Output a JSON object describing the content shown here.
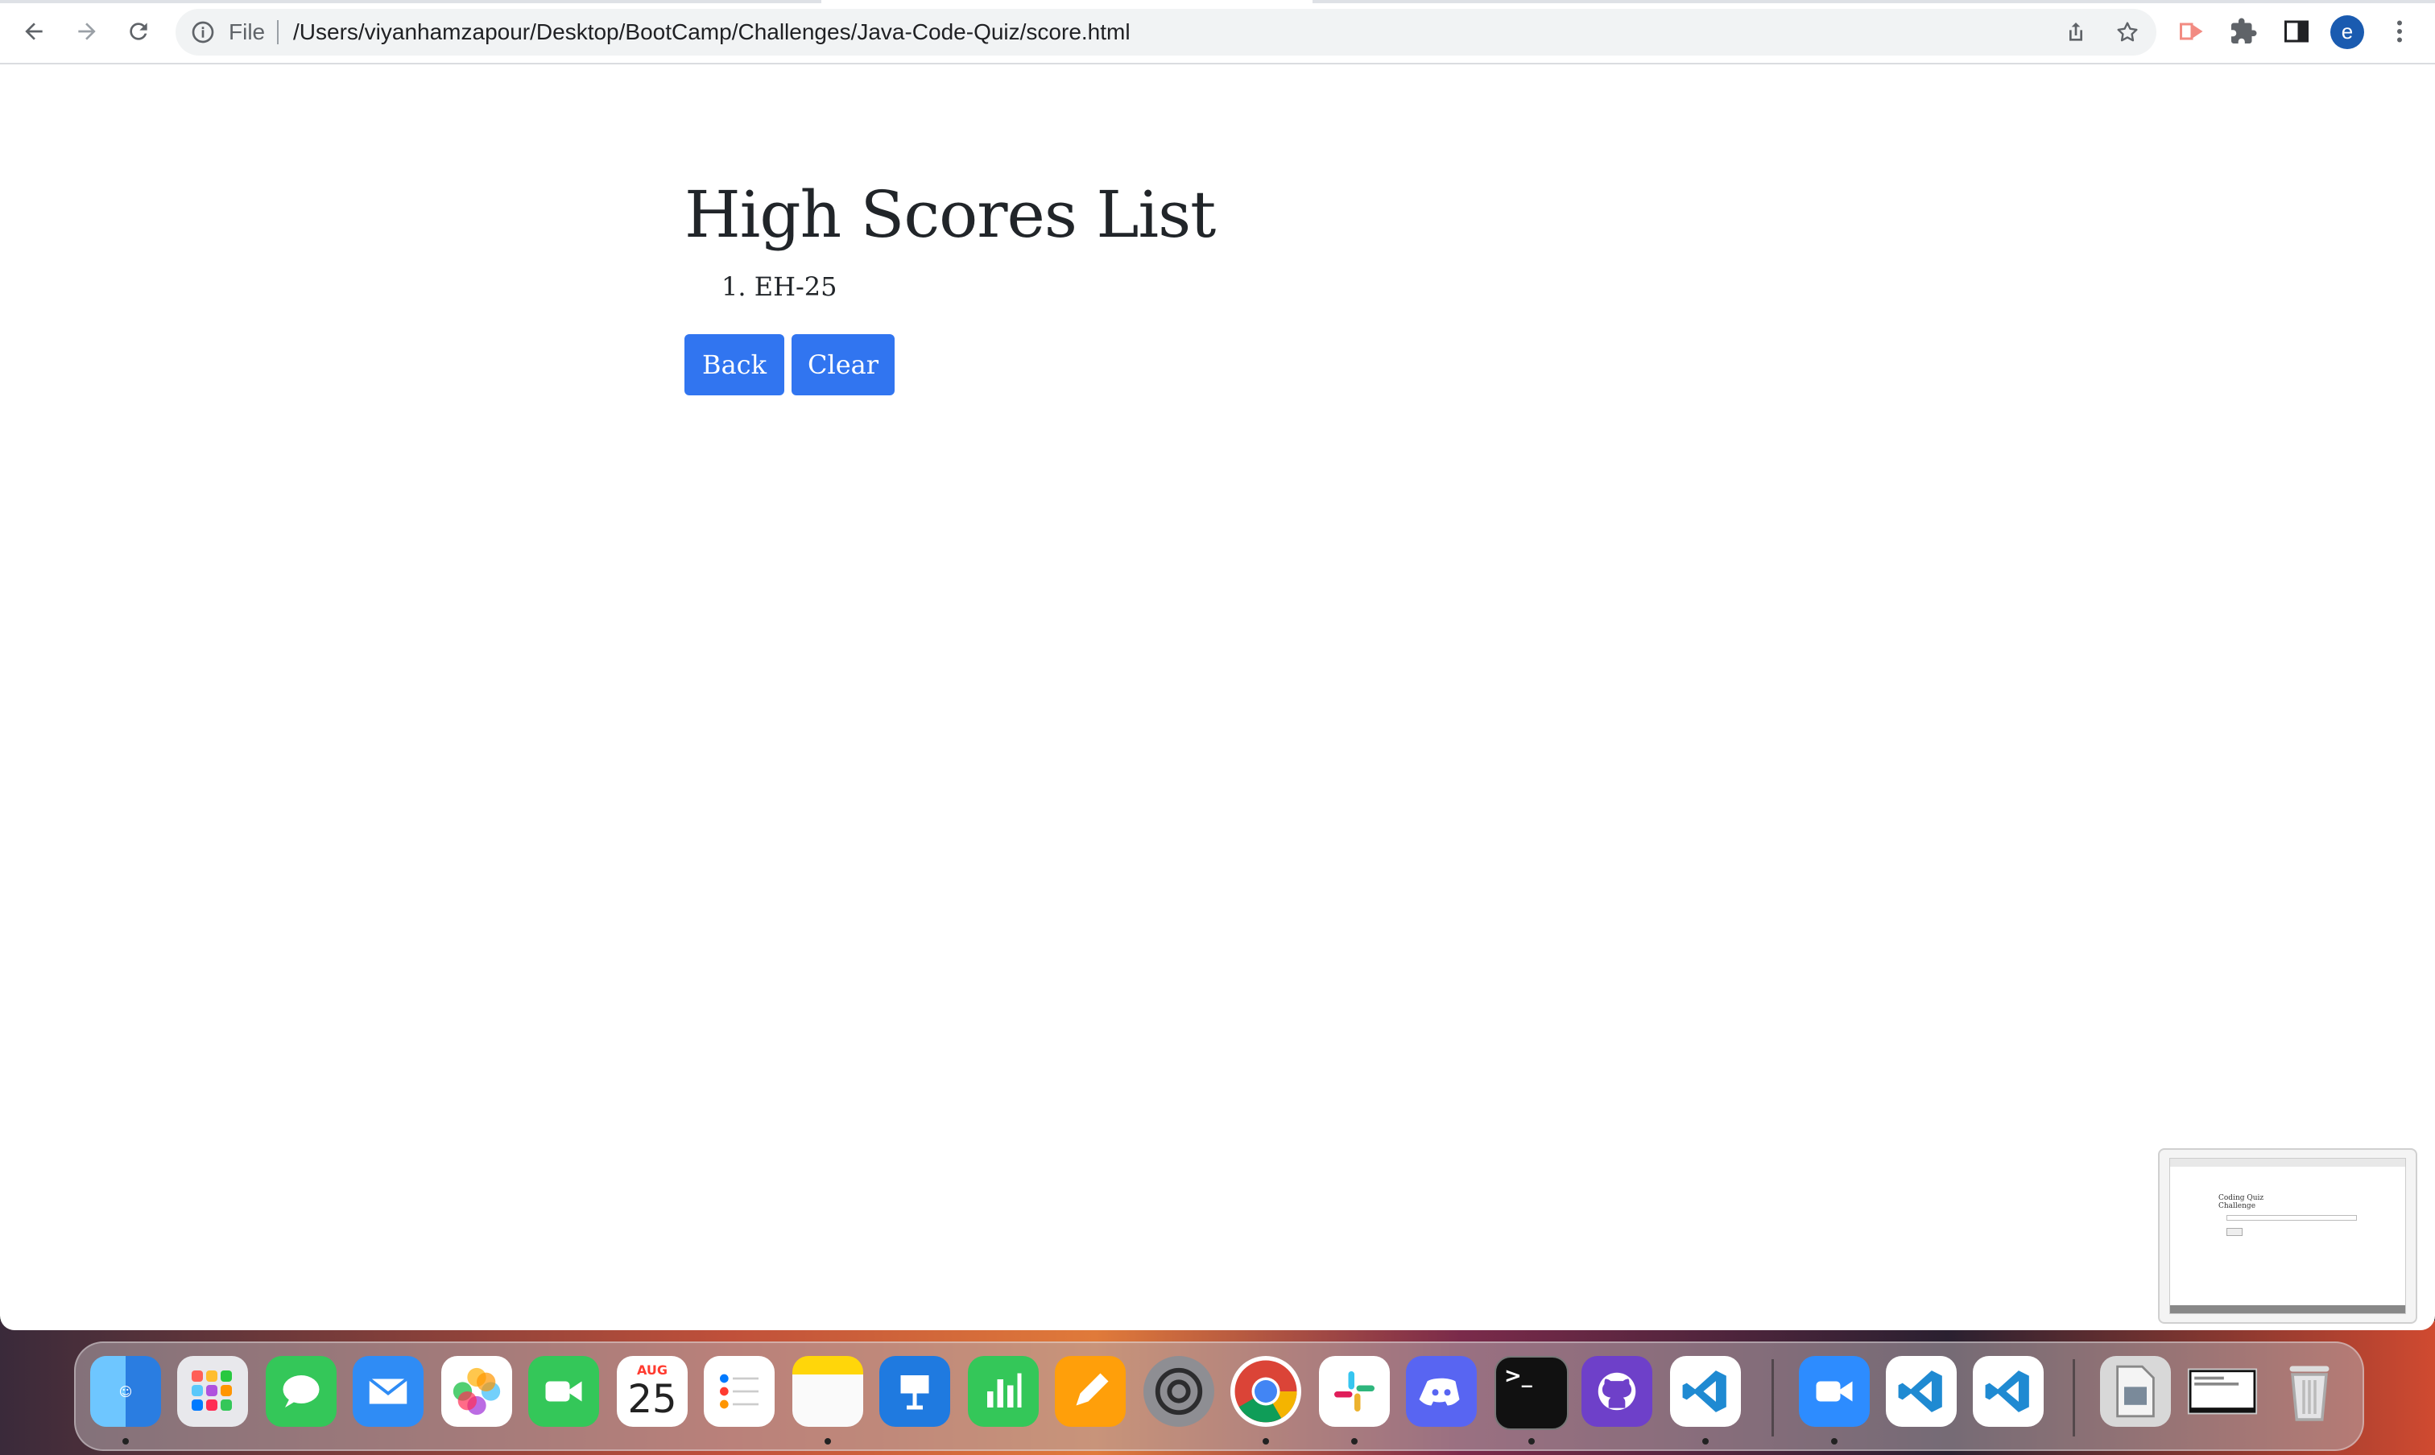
{
  "browser": {
    "address_bar": {
      "scheme_label": "File",
      "url": "/Users/viyanhamzapour/Desktop/BootCamp/Challenges/Java-Code-Quiz/score.html"
    },
    "profile_initial": "e",
    "icons": {
      "back": "back-arrow-icon",
      "forward": "forward-arrow-icon",
      "reload": "reload-icon",
      "info": "info-icon",
      "share": "share-icon",
      "bookmark": "star-icon",
      "extension_red": "cast-icon",
      "extensions": "puzzle-icon",
      "side_panel": "side-panel-icon",
      "menu": "kebab-menu-icon"
    }
  },
  "page": {
    "title": "High Scores List",
    "scores": [
      "EH-25"
    ],
    "back_button": "Back",
    "clear_button": "Clear"
  },
  "thumbnail": {
    "title_line1": "Coding Quiz",
    "title_line2": "Challenge"
  },
  "dock": {
    "calendar_month": "AUG",
    "calendar_day": "25",
    "apps": [
      "Finder",
      "Launchpad",
      "Messages",
      "Mail",
      "Photos",
      "FaceTime",
      "Calendar",
      "Reminders",
      "Notes",
      "Keynote",
      "Numbers",
      "Pages",
      "System Preferences",
      "Chrome",
      "Slack",
      "Discord",
      "Terminal",
      "GitHub Desktop",
      "VS Code",
      "Zoom",
      "VS Code",
      "VS Code",
      "Preview",
      "Screenshot",
      "Trash"
    ],
    "terminal_prompt": ">_"
  },
  "colors": {
    "button_primary": "#3175f0",
    "text": "#212529",
    "avatar": "#1a5bb0"
  }
}
